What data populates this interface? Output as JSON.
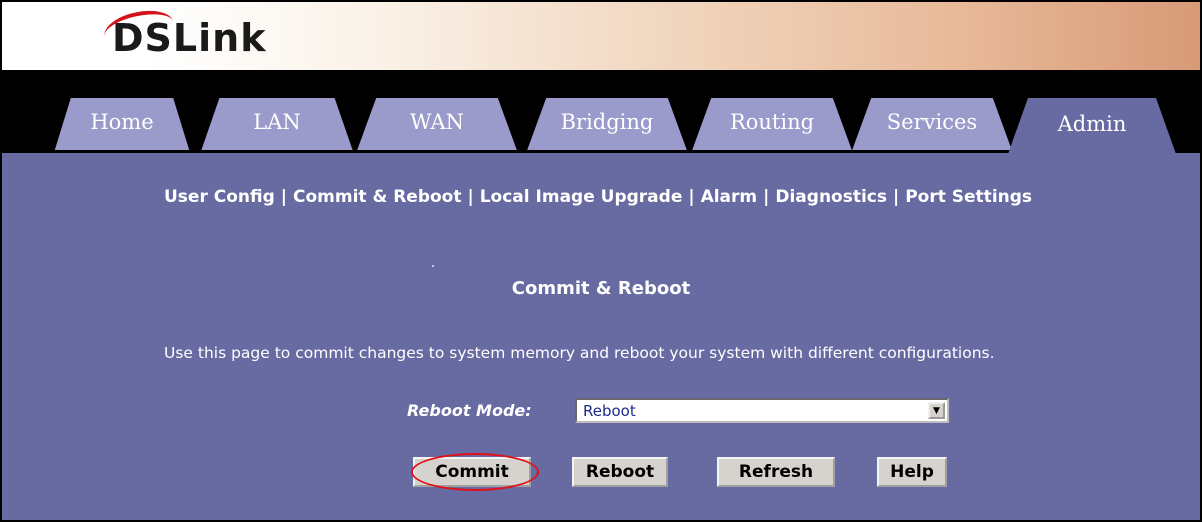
{
  "brand": {
    "logo_text": "DSLink"
  },
  "tabs": [
    {
      "label": "Home",
      "active": false
    },
    {
      "label": "LAN",
      "active": false
    },
    {
      "label": "WAN",
      "active": false
    },
    {
      "label": "Bridging",
      "active": false
    },
    {
      "label": "Routing",
      "active": false
    },
    {
      "label": "Services",
      "active": false
    },
    {
      "label": "Admin",
      "active": true
    }
  ],
  "subnav": {
    "items": [
      "User Config",
      "Commit & Reboot",
      "Local Image Upgrade",
      "Alarm",
      "Diagnostics",
      "Port Settings"
    ],
    "separator": "|"
  },
  "page": {
    "title": "Commit & Reboot",
    "description": "Use this page to commit changes to system memory and reboot your system with different configurations."
  },
  "form": {
    "reboot_mode_label": "Reboot Mode:",
    "reboot_mode_value": "Reboot"
  },
  "buttons": {
    "commit": "Commit",
    "reboot": "Reboot",
    "refresh": "Refresh",
    "help": "Help"
  },
  "colors": {
    "content_bg": "#686aa2",
    "tab_inactive": "#9a9acb",
    "highlight": "#e3101a"
  }
}
